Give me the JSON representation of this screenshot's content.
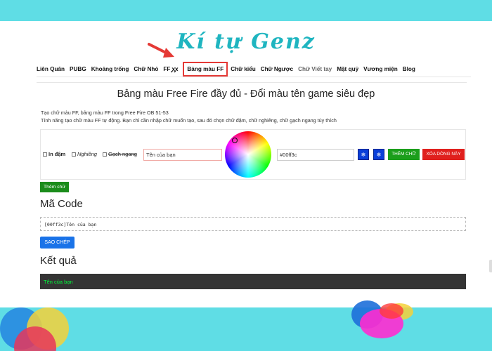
{
  "site": {
    "logo": "Kí tự Genz"
  },
  "nav": {
    "items": [
      {
        "label": "Liên Quân"
      },
      {
        "label": "PUBG"
      },
      {
        "label": "Khoảng trống"
      },
      {
        "label": "Chữ Nhỏ"
      },
      {
        "label": "FF ꭙꭙ"
      },
      {
        "label": "Bảng màu FF",
        "active": true
      },
      {
        "label": "Chữ kiểu"
      },
      {
        "label": "Chữ Ngược"
      },
      {
        "label": "Chữ Viết tay"
      },
      {
        "label": "Mặt quỷ"
      },
      {
        "label": "Vương miện"
      },
      {
        "label": "Blog"
      }
    ]
  },
  "page": {
    "title": "Bảng màu Free Fire đầy đủ - Đổi màu tên game siêu đẹp",
    "desc_line1": "Tạo chữ màu FF, bảng màu FF trong Free Fire OB 51-53",
    "desc_line2": "Tính năng tạo chữ màu FF tự động. Bạn chỉ cần nhập chữ muốn tạo, sau đó chọn chữ đậm, chữ nghiêng, chữ gạch ngang tùy thích"
  },
  "panel": {
    "bold_label": "In đậm",
    "italic_label": "Nghiêng",
    "strike_label": "Gạch ngang",
    "name_value": "Tên của bạn",
    "hex_value": "#00ff3c",
    "icon_btn1": "❄",
    "icon_btn2": "❄",
    "add_text_label": "THÊM CHỮ",
    "delete_row_label": "XÓA DÒNG NÀY"
  },
  "add_button": "Thêm chữ",
  "code_section": {
    "heading": "Mã Code",
    "code": "[00ff3c]Tên của bạn",
    "copy_label": "SAO CHÉP"
  },
  "result_section": {
    "heading": "Kết quả",
    "text": "Tên của bạn"
  },
  "colors": {
    "background": "#5fdde5",
    "result_text": "#00ff3c",
    "active_border": "#e53935"
  }
}
